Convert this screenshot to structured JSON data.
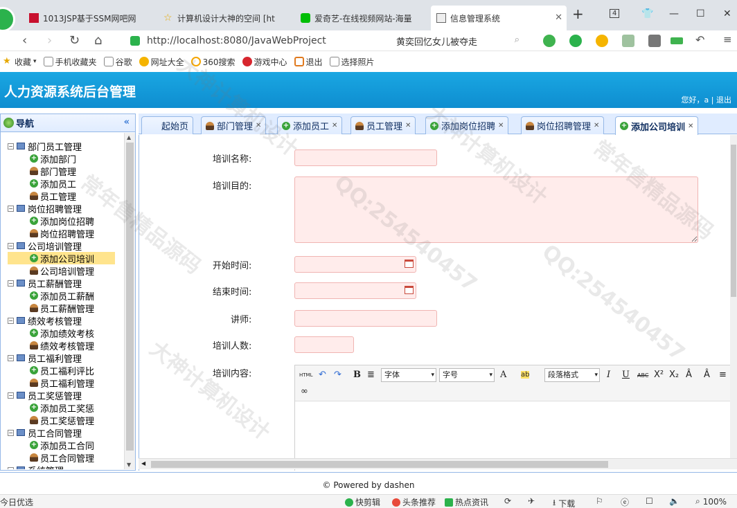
{
  "browser": {
    "tabs": [
      {
        "label": "1013JSP基于SSM网吧网"
      },
      {
        "label": "计算机设计大神的空间 [ht"
      },
      {
        "label": "爱奇艺-在线视频网站-海量"
      },
      {
        "label": "信息管理系统"
      }
    ],
    "tab_count": "4",
    "url": "http://localhost:8080/JavaWebProject",
    "search_text": "黄奕回忆女儿被夺走",
    "bookmarks": [
      "收藏",
      "手机收藏夹",
      "谷歌",
      "网址大全",
      "360搜索",
      "游戏中心",
      "退出",
      "选择照片"
    ]
  },
  "app": {
    "title": "人力资源系统后台管理",
    "user_greeting": "您好，a",
    "logout": "退出",
    "nav_title": "导航"
  },
  "tree": [
    {
      "label": "部门员工管理",
      "kind": "group"
    },
    {
      "label": "添加部门",
      "kind": "add"
    },
    {
      "label": "部门管理",
      "kind": "user"
    },
    {
      "label": "添加员工",
      "kind": "add"
    },
    {
      "label": "员工管理",
      "kind": "user"
    },
    {
      "label": "岗位招聘管理",
      "kind": "group"
    },
    {
      "label": "添加岗位招聘",
      "kind": "add"
    },
    {
      "label": "岗位招聘管理",
      "kind": "user"
    },
    {
      "label": "公司培训管理",
      "kind": "group"
    },
    {
      "label": "添加公司培训",
      "kind": "add",
      "selected": true
    },
    {
      "label": "公司培训管理",
      "kind": "user"
    },
    {
      "label": "员工薪酬管理",
      "kind": "group"
    },
    {
      "label": "添加员工薪酬",
      "kind": "add"
    },
    {
      "label": "员工薪酬管理",
      "kind": "user"
    },
    {
      "label": "绩效考核管理",
      "kind": "group"
    },
    {
      "label": "添加绩效考核",
      "kind": "add"
    },
    {
      "label": "绩效考核管理",
      "kind": "user"
    },
    {
      "label": "员工福利管理",
      "kind": "group"
    },
    {
      "label": "员工福利评比",
      "kind": "add"
    },
    {
      "label": "员工福利管理",
      "kind": "user"
    },
    {
      "label": "员工奖惩管理",
      "kind": "group"
    },
    {
      "label": "添加员工奖惩",
      "kind": "add"
    },
    {
      "label": "员工奖惩管理",
      "kind": "user"
    },
    {
      "label": "员工合同管理",
      "kind": "group"
    },
    {
      "label": "添加员工合同",
      "kind": "add"
    },
    {
      "label": "员工合同管理",
      "kind": "user"
    },
    {
      "label": "系统管理",
      "kind": "group"
    }
  ],
  "content_tabs": [
    {
      "label": "起始页",
      "icon": "none",
      "closable": false
    },
    {
      "label": "部门管理",
      "icon": "user",
      "closable": true
    },
    {
      "label": "添加员工",
      "icon": "add",
      "closable": true
    },
    {
      "label": "员工管理",
      "icon": "user",
      "closable": true
    },
    {
      "label": "添加岗位招聘",
      "icon": "add",
      "closable": true
    },
    {
      "label": "岗位招聘管理",
      "icon": "user",
      "closable": true
    },
    {
      "label": "添加公司培训",
      "icon": "add",
      "closable": true,
      "active": true
    }
  ],
  "form": {
    "name_label": "培训名称:",
    "name_value": "",
    "purpose_label": "培训目的:",
    "purpose_value": "",
    "start_label": "开始时间:",
    "start_value": "",
    "end_label": "结束时间:",
    "end_value": "",
    "teacher_label": "讲师:",
    "teacher_value": "",
    "count_label": "培训人数:",
    "count_value": "",
    "content_label": "培训内容:"
  },
  "editor": {
    "html_label": "HTML",
    "font_placeholder": "字体",
    "size_placeholder": "字号",
    "paragraph_placeholder": "段落格式",
    "bold": "B",
    "italic": "I",
    "underline": "U",
    "strike": "ABC",
    "font_color": "A",
    "highlight": "ab"
  },
  "footer": {
    "text": "© Powered by dashen"
  },
  "statusbar": {
    "left": "今日优选",
    "items": [
      "快剪辑",
      "头条推荐",
      "热点资讯"
    ],
    "download": "下载",
    "zoom": "100%"
  },
  "watermark": {
    "lines": [
      "大神计算机设计",
      "QQ:254540457",
      "常年售精品源码"
    ]
  }
}
